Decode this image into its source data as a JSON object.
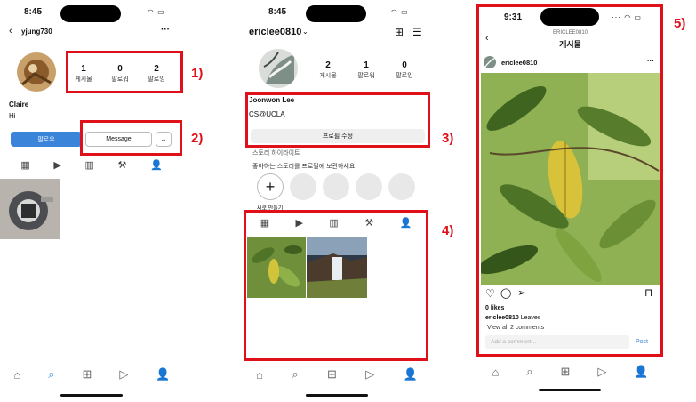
{
  "phone1": {
    "status_time": "8:45",
    "username": "yjung730",
    "stats": [
      {
        "num": "1",
        "label": "게시물"
      },
      {
        "num": "0",
        "label": "팔로워"
      },
      {
        "num": "2",
        "label": "팔로잉"
      }
    ],
    "name": "Claire",
    "bio": "Hi",
    "follow_label": "팔로우",
    "message_label": "Message"
  },
  "phone2": {
    "status_time": "8:45",
    "username": "ericlee0810",
    "stats": [
      {
        "num": "2",
        "label": "게시물"
      },
      {
        "num": "1",
        "label": "팔로워"
      },
      {
        "num": "0",
        "label": "팔로잉"
      }
    ],
    "name": "Joonwon Lee",
    "bio": "CS@UCLA",
    "edit_profile_label": "프로필 수정",
    "highlights_title": "스토리 하이라이트",
    "highlights_subtitle": "좋아하는 스토리를 프로필에 보관하세요",
    "new_label": "새로 만들기"
  },
  "phone3": {
    "status_time": "9:31",
    "header_small": "ERICLEE0810",
    "header_title": "게시물",
    "post_user": "ericlee0810",
    "likes": "0 likes",
    "caption_user": "ericlee0810",
    "caption_text": "Leaves",
    "view_comments": "View all 2 comments",
    "comment_placeholder": "Add a comment...",
    "post_label": "Post"
  },
  "annotations": [
    "1)",
    "2)",
    "3)",
    "4)",
    "5)"
  ],
  "colors": {
    "highlight": "#e0101a",
    "accent": "#3a84d9"
  }
}
